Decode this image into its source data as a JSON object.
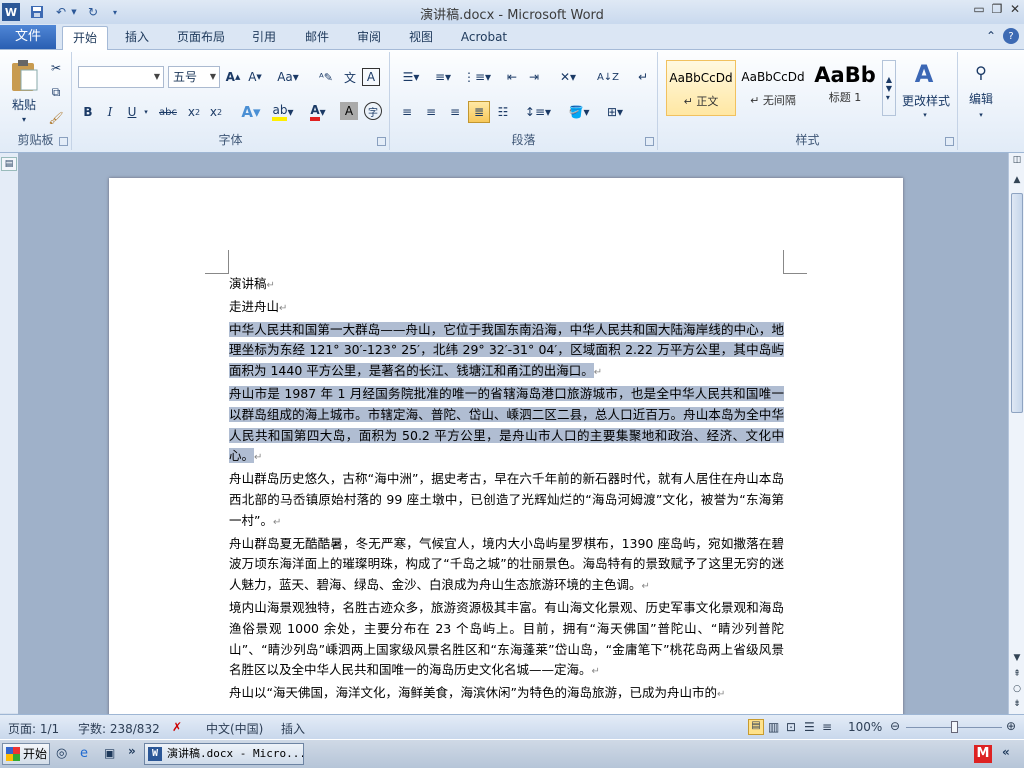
{
  "window": {
    "title": "演讲稿.docx - Microsoft Word",
    "qat_icons": [
      "word-app-icon",
      "save-icon",
      "undo-icon",
      "redo-icon",
      "customize-qat-icon"
    ]
  },
  "tabs": {
    "file": "文件",
    "items": [
      "开始",
      "插入",
      "页面布局",
      "引用",
      "邮件",
      "审阅",
      "视图",
      "Acrobat"
    ],
    "active": "开始"
  },
  "ribbon": {
    "clipboard": {
      "label": "剪贴板",
      "paste": "粘贴"
    },
    "font": {
      "label": "字体",
      "font_name": "",
      "font_size": "五号"
    },
    "paragraph": {
      "label": "段落"
    },
    "styles": {
      "label": "样式",
      "items": [
        {
          "sample": "AaBbCcDd",
          "name": "↵ 正文"
        },
        {
          "sample": "AaBbCcDd",
          "name": "↵ 无间隔"
        },
        {
          "sample": "AaBb",
          "name": "标题 1"
        }
      ],
      "change_styles": "更改样式"
    },
    "editing": {
      "label": "编辑"
    }
  },
  "document": {
    "paragraphs": [
      {
        "text": "演讲稿",
        "highlight": false
      },
      {
        "text": "走进舟山",
        "highlight": false
      },
      {
        "text": "中华人民共和国第一大群岛——舟山，它位于我国东南沿海，中华人民共和国大陆海岸线的中心，地理坐标为东经 121° 30′-123° 25′，北纬 29° 32′-31° 04′，区域面积 2.22 万平方公里，其中岛屿面积为 1440 平方公里，是著名的长江、钱塘江和甬江的出海口。",
        "highlight": true
      },
      {
        "text": "舟山市是 1987 年 1 月经国务院批准的唯一的省辖海岛港口旅游城市，也是全中华人民共和国唯一以群岛组成的海上城市。市辖定海、普陀、岱山、嵊泗二区二县，总人口近百万。舟山本岛为全中华人民共和国第四大岛，面积为 50.2 平方公里，是舟山市人口的主要集聚地和政治、经济、文化中心。",
        "highlight": true
      },
      {
        "text": "舟山群岛历史悠久，古称“海中洲”，据史考古，早在六千年前的新石器时代，就有人居住在舟山本岛西北部的马岙镇原始村落的 99 座土墩中，已创造了光辉灿烂的“海岛河姆渡”文化，被誉为“东海第一村”。",
        "highlight": false
      },
      {
        "text": "舟山群岛夏无酷酷暑，冬无严寒，气候宜人，境内大小岛屿星罗棋布，1390 座岛屿，宛如撒落在碧波万顷东海洋面上的璀璨明珠，构成了“千岛之城”的壮丽景色。海岛特有的景致赋予了这里无穷的迷人魅力，蓝天、碧海、绿岛、金沙、白浪成为舟山生态旅游环境的主色调。",
        "highlight": false
      },
      {
        "text": "境内山海景观独特，名胜古迹众多，旅游资源极其丰富。有山海文化景观、历史军事文化景观和海岛渔俗景观 1000 余处，主要分布在 23 个岛屿上。目前，拥有“海天佛国”普陀山、“睛沙列普陀山”、“睛沙列岛”嵊泗两上国家级风景名胜区和“东海蓬莱”岱山岛，“金庸笔下”桃花岛两上省级风景名胜区以及全中华人民共和国唯一的海岛历史文化名城——定海。",
        "highlight": false
      },
      {
        "text": "舟山以“海天佛国，海洋文化，海鲜美食，海滨休闲”为特色的海岛旅游，已成为舟山市的",
        "highlight": false
      }
    ]
  },
  "status": {
    "page": "页面: 1/1",
    "words": "字数: 238/832",
    "language": "中文(中国)",
    "mode": "插入",
    "zoom": "100%",
    "zoom_level": 100
  },
  "taskbar": {
    "start": "开始",
    "window_item": "演讲稿.docx - Micro..."
  }
}
